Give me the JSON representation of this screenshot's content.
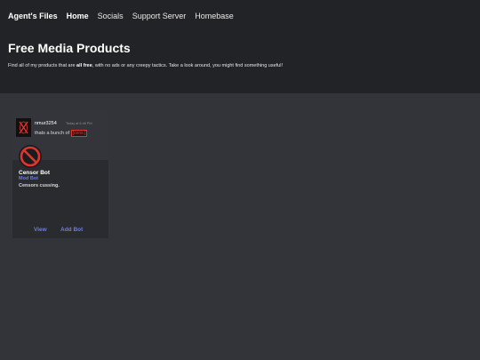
{
  "nav": {
    "brand": "Agent's Files",
    "links": [
      "Home",
      "Socials",
      "Support Server",
      "Homebase"
    ]
  },
  "hero": {
    "title": "Free Media Products",
    "subtitle_before": "Find all of my products that are ",
    "subtitle_bold": "all free",
    "subtitle_after": ", with no ads or any creepy tactics. Take a look around, you might find something useful!"
  },
  "card": {
    "message": {
      "username": "nmur3254",
      "timestamp": "Today at 6:48 PM",
      "text": "thats a bunch of",
      "censored_word": "[cens.]"
    },
    "name": "Censor Bot",
    "tag": "Mod Bot",
    "description": "Censors cussing.",
    "buttons": {
      "view": "View",
      "add": "Add Bot"
    }
  },
  "icons": {
    "avatar": "red-x-logo-icon",
    "bot": "prohibited-icon"
  },
  "colors": {
    "topbar": "#222326",
    "page": "#33343a",
    "accent": "#6f79e8",
    "censor_red": "#e0342f"
  }
}
